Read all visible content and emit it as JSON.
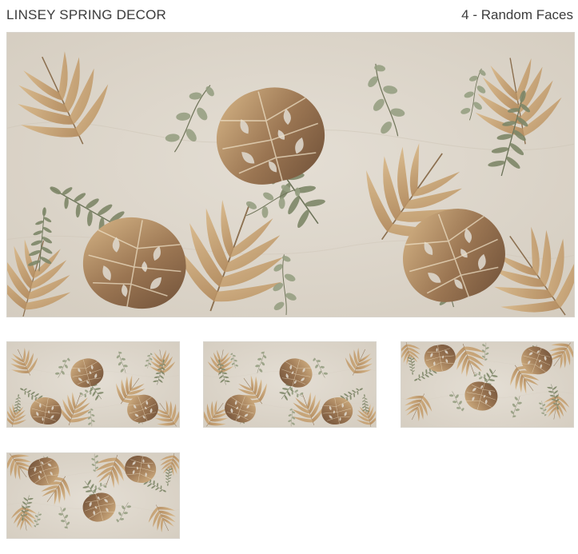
{
  "header": {
    "title": "LINSEY SPRING DECOR",
    "faces_label": "4 - Random Faces"
  },
  "palette": {
    "background": "#ddd6cb",
    "leaf_brown": "#8a6a4c",
    "leaf_tan": "#c9a678",
    "leaf_sage": "#8f977b",
    "leaf_olive": "#6f7659",
    "vein": "#efe6d6"
  }
}
